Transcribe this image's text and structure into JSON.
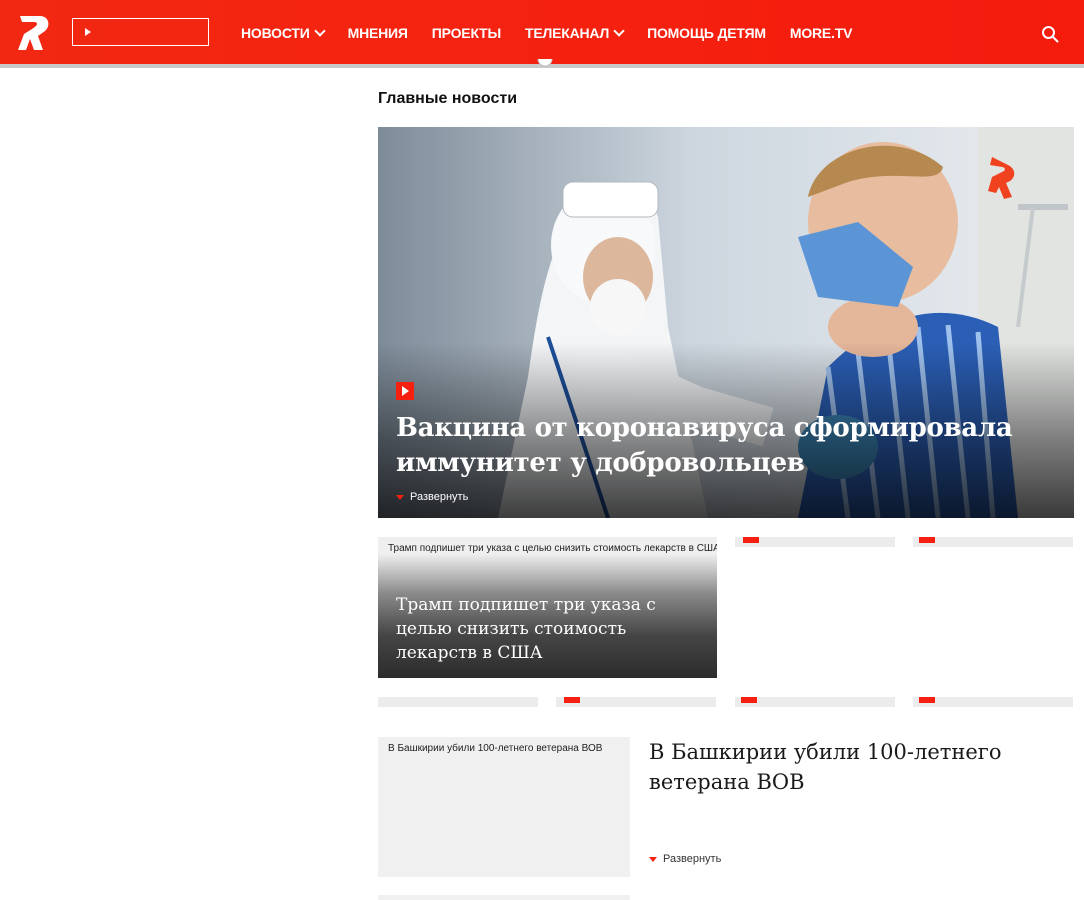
{
  "header": {
    "logo_name": "ren-tv-logo",
    "nav": [
      {
        "label": "НОВОСТИ",
        "has_dropdown": true
      },
      {
        "label": "МНЕНИЯ",
        "has_dropdown": false
      },
      {
        "label": "ПРОЕКТЫ",
        "has_dropdown": false
      },
      {
        "label": "ТЕЛЕКАНАЛ",
        "has_dropdown": true
      },
      {
        "label": "ПОМОЩЬ ДЕТЯМ",
        "has_dropdown": false
      },
      {
        "label": "MORE.TV",
        "has_dropdown": false
      }
    ],
    "colors": {
      "brand": "#f5200f",
      "text": "#ffffff"
    }
  },
  "main": {
    "section_title": "Главные новости",
    "hero": {
      "title": "Вакцина от коронавируса сформировала иммунитет у добровольцев",
      "expand_label": "Развернуть"
    },
    "card_trump": {
      "alt_text": "Трамп подпишет три указа с целью снизить стоимость лекарств в США",
      "title": "Трамп подпишет три указа с целью снизить стоимость лекарств в США"
    },
    "article_bashkiria": {
      "alt_text": "В Башкирии убили 100-летнего ветерана ВОВ",
      "title": "В Башкирии убили 100-летнего ветерана ВОВ",
      "expand_label": "Развернуть"
    }
  }
}
